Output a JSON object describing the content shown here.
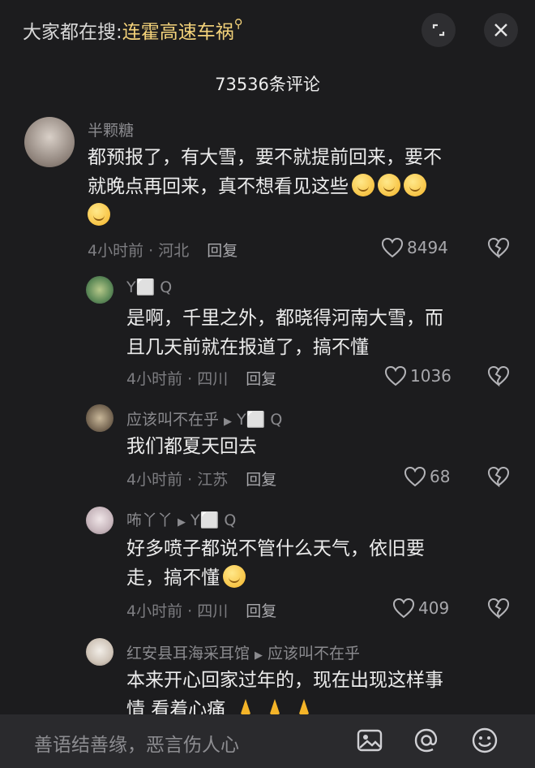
{
  "header": {
    "trend_prefix": "大家都在搜:",
    "trend_keyword": "连霍高速车祸",
    "comment_count": "73536条评论"
  },
  "comments": [
    {
      "user": "半颗糖",
      "text_line1": "都预报了，有大雪，要不就提前回来，要不",
      "text_line2": "就晚点再回来，真不想看见这些",
      "time_loc": "4小时前 · 河北",
      "reply": "回复",
      "likes": "8494"
    },
    {
      "user": "Y⬜ Q",
      "text_line1": "是啊，千里之外，都晓得河南大雪，而",
      "text_line2": "且几天前就在报道了，搞不懂",
      "time_loc": "4小时前 · 四川",
      "reply": "回复",
      "likes": "1036"
    },
    {
      "user": "应该叫不在乎",
      "reply_to": "Y⬜ Q",
      "text_line1": "我们都夏天回去",
      "time_loc": "4小时前 · 江苏",
      "reply": "回复",
      "likes": "68"
    },
    {
      "user": "咘丫丫",
      "reply_to": "Y⬜ Q",
      "text_line1": "好多喷子都说不管什么天气，依旧要",
      "text_line2": "走，搞不懂",
      "time_loc": "4小时前 · 四川",
      "reply": "回复",
      "likes": "409"
    },
    {
      "user": "红安县耳海采耳馆",
      "reply_to": "应该叫不在乎",
      "text_line1": "本来开心回家过年的，现在出现这样事",
      "text_line2": "情 看着心痛"
    }
  ],
  "input": {
    "placeholder": "善语结善缘，恶言伤人心"
  },
  "icons": {
    "fullscreen": "expand-icon",
    "close": "close-icon",
    "like": "heart-icon",
    "dislike": "broken-heart-icon",
    "image": "image-icon",
    "mention": "at-icon",
    "emoji": "emoji-icon"
  },
  "colors": {
    "background": "#1c1c1e",
    "keyword": "#f3d27a",
    "muted": "#8a8a8e"
  }
}
